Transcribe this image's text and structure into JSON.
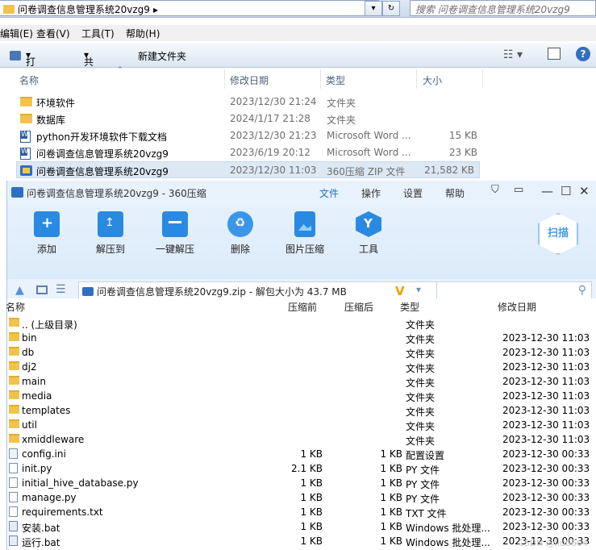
{
  "explorer": {
    "address_path": "问卷调查信息管理系统20vzg9",
    "search_placeholder": "搜索 问卷调查信息管理系统20vzg9",
    "menu": [
      "编辑(E)",
      "查看(V)",
      "工具(T)",
      "帮助(H)"
    ],
    "toolbar": {
      "open": "打开",
      "share": "共享",
      "new_folder": "新建文件夹"
    },
    "columns": {
      "name": "名称",
      "modified": "修改日期",
      "type": "类型",
      "size": "大小"
    },
    "rows": [
      {
        "icon": "folder-icon",
        "name": "环境软件",
        "date": "2023/12/30 21:24",
        "type": "文件夹",
        "size": ""
      },
      {
        "icon": "folder-icon",
        "name": "数据库",
        "date": "2024/1/17 21:28",
        "type": "文件夹",
        "size": ""
      },
      {
        "icon": "word-doc-icon",
        "name": "python开发环境软件下载文档",
        "date": "2023/12/30 21:23",
        "type": "Microsoft Word ...",
        "size": "15 KB"
      },
      {
        "icon": "word-doc-icon",
        "name": "问卷调查信息管理系统20vzg9",
        "date": "2023/6/19 20:12",
        "type": "Microsoft Word ...",
        "size": "23 KB"
      },
      {
        "icon": "zip-icon",
        "name": "问卷调查信息管理系统20vzg9",
        "date": "2023/12/30 11:03",
        "type": "360压缩 ZIP 文件",
        "size": "21,582 KB",
        "selected": true
      }
    ]
  },
  "zip": {
    "title": "问卷调查信息管理系统20vzg9 - 360压缩",
    "menu": [
      "文件",
      "操作",
      "设置",
      "帮助"
    ],
    "toolbar": [
      "添加",
      "解压到",
      "一键解压",
      "删除",
      "图片压缩",
      "工具"
    ],
    "scan_label": "扫描",
    "address": "问卷调查信息管理系统20vzg9.zip - 解包大小为 43.7 MB",
    "columns": {
      "name": "名称",
      "compressed": "压缩前",
      "after": "压缩后",
      "type": "类型",
      "modified": "修改日期"
    },
    "rows": [
      {
        "kind": "folder",
        "name": ".. (上级目录)",
        "c1": "",
        "c2": "",
        "type": "文件夹",
        "date": ""
      },
      {
        "kind": "folder",
        "name": "bin",
        "c1": "",
        "c2": "",
        "type": "文件夹",
        "date": "2023-12-30 11:03"
      },
      {
        "kind": "folder",
        "name": "db",
        "c1": "",
        "c2": "",
        "type": "文件夹",
        "date": "2023-12-30 11:03"
      },
      {
        "kind": "folder",
        "name": "dj2",
        "c1": "",
        "c2": "",
        "type": "文件夹",
        "date": "2023-12-30 11:03"
      },
      {
        "kind": "folder",
        "name": "main",
        "c1": "",
        "c2": "",
        "type": "文件夹",
        "date": "2023-12-30 11:03"
      },
      {
        "kind": "folder",
        "name": "media",
        "c1": "",
        "c2": "",
        "type": "文件夹",
        "date": "2023-12-30 11:03"
      },
      {
        "kind": "folder",
        "name": "templates",
        "c1": "",
        "c2": "",
        "type": "文件夹",
        "date": "2023-12-30 11:03"
      },
      {
        "kind": "folder",
        "name": "util",
        "c1": "",
        "c2": "",
        "type": "文件夹",
        "date": "2023-12-30 11:03"
      },
      {
        "kind": "folder",
        "name": "xmiddleware",
        "c1": "",
        "c2": "",
        "type": "文件夹",
        "date": "2023-12-30 11:03"
      },
      {
        "kind": "cfg",
        "name": "config.ini",
        "c1": "1 KB",
        "c2": "1 KB",
        "type": "配置设置",
        "date": "2023-12-30 00:33"
      },
      {
        "kind": "file",
        "name": "init.py",
        "c1": "2.1 KB",
        "c2": "1 KB",
        "type": "PY 文件",
        "date": "2023-12-30 00:33"
      },
      {
        "kind": "file",
        "name": "initial_hive_database.py",
        "c1": "1 KB",
        "c2": "1 KB",
        "type": "PY 文件",
        "date": "2023-12-30 00:33"
      },
      {
        "kind": "file",
        "name": "manage.py",
        "c1": "1 KB",
        "c2": "1 KB",
        "type": "PY 文件",
        "date": "2023-12-30 00:33"
      },
      {
        "kind": "file",
        "name": "requirements.txt",
        "c1": "1 KB",
        "c2": "1 KB",
        "type": "TXT 文件",
        "date": "2023-12-30 00:33"
      },
      {
        "kind": "bat",
        "name": "安装.bat",
        "c1": "1 KB",
        "c2": "1 KB",
        "type": "Windows 批处理...",
        "date": "2023-12-30 00:33"
      },
      {
        "kind": "bat",
        "name": "运行.bat",
        "c1": "1 KB",
        "c2": "1 KB",
        "type": "Windows 批处理...",
        "date": "2023-12-30 00:33"
      }
    ]
  },
  "watermark": "CSDN @liu0664"
}
